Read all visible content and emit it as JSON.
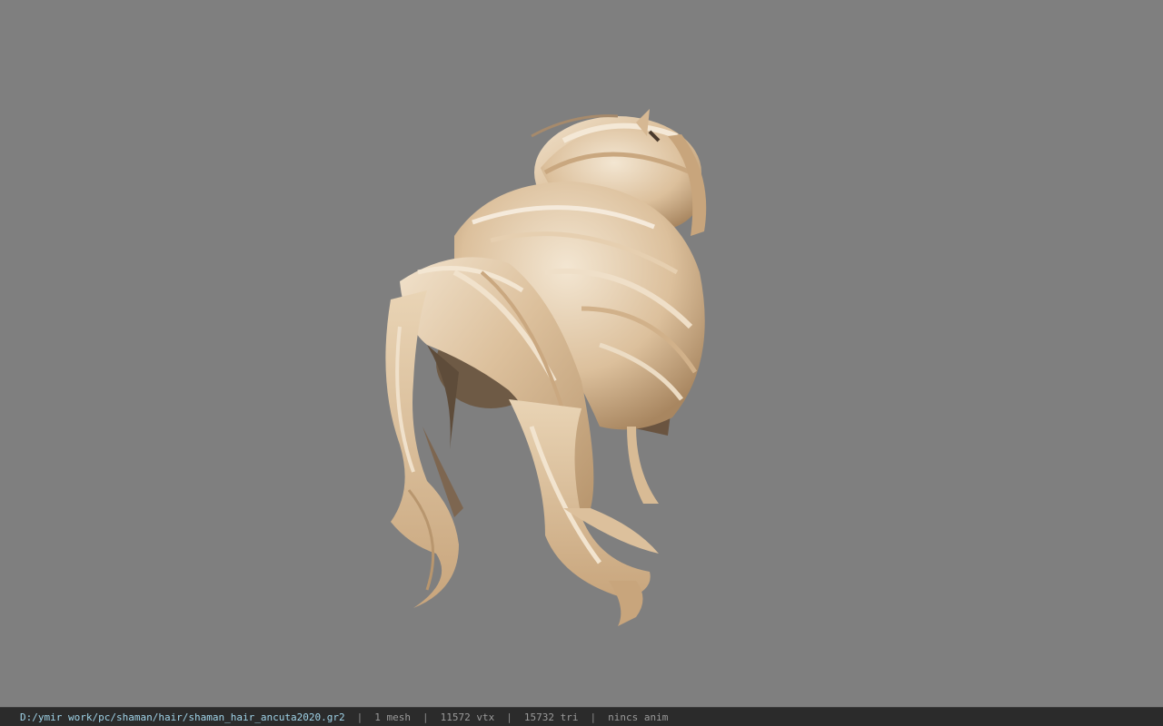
{
  "viewport": {
    "background": "#7f7f7f",
    "model": {
      "description_icon": "hair-mesh-model",
      "base_color": "#dcc09c",
      "highlight_color": "#f1e2cc",
      "shadow_color": "#8a6f52"
    }
  },
  "statusbar": {
    "file_path": "D:/ymir work/pc/shaman/hair/shaman_hair_ancuta2020.gr2",
    "separator": "|",
    "mesh_count": "1 mesh",
    "vertex_count": "11572 vtx",
    "triangle_count": "15732 tri",
    "animation": "nincs anim",
    "path_color": "#9fd3e8",
    "text_color": "#9a9a9a",
    "background": "#2b2b2b"
  }
}
